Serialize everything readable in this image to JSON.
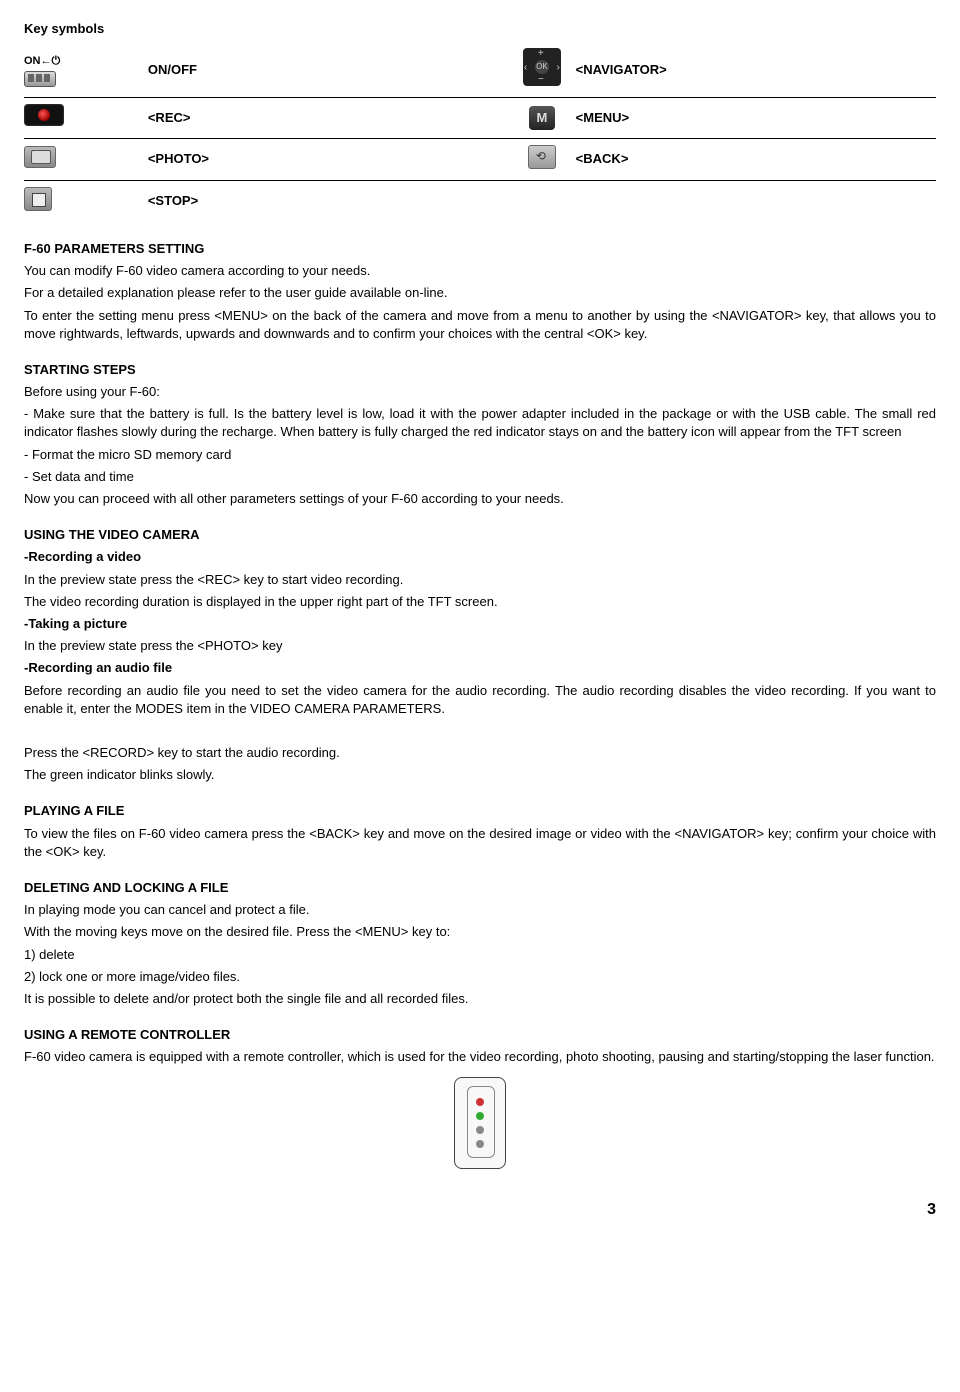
{
  "header": {
    "keySymbols": "Key symbols"
  },
  "symbols": {
    "onoff": "ON/OFF",
    "navigator": "<NAVIGATOR>",
    "rec": "<REC>",
    "menu": "<MENU>",
    "photo": "<PHOTO>",
    "back": "<BACK>",
    "stop": "<STOP>",
    "onArrow": "ON←⏻"
  },
  "params": {
    "title": "F-60 PARAMETERS SETTING",
    "p1": "You can modify F-60 video camera according to your needs.",
    "p2": "For a detailed explanation please refer to the user guide available on-line.",
    "p3": "To enter the setting menu press <MENU> on the back of the camera and move from a menu to another by using the <NAVIGATOR> key, that allows you to move rightwards, leftwards, upwards and downwards and to confirm your choices with the central  <OK> key."
  },
  "starting": {
    "title": "STARTING STEPS",
    "before": "Before using your F-60:",
    "l1": "- Make sure that the battery is full. Is the battery level is low, load it with the power adapter included in the package or with the USB cable. The small red indicator flashes slowly during the recharge. When battery is fully charged the red indicator stays on and the battery icon will appear from the TFT screen",
    "l2": "- Format the micro SD memory card",
    "l3": "- Set data and time",
    "after": "Now you can proceed with all other parameters settings of your F-60 according to your needs."
  },
  "usingVideo": {
    "title": "USING THE VIDEO CAMERA",
    "recHeading": "-Recording a video",
    "rec1": "In the preview state press the <REC> key to start video recording.",
    "rec2": "The video recording duration is displayed in the upper right part of the TFT screen.",
    "photoHeading": "-Taking a picture",
    "photo1": "In the preview state press the <PHOTO> key",
    "audioHeading": "-Recording an audio file",
    "audio1": "Before recording an audio file you need to set the video camera for the audio recording. The audio recording disables the video recording. If you want to enable it, enter the MODES item in the VIDEO CAMERA PARAMETERS.",
    "press": "Press the  <RECORD> key to start the audio recording.",
    "green": "The green indicator blinks slowly."
  },
  "playing": {
    "title": "PLAYING A FILE",
    "p1": "To view the files on F-60 video camera press the <BACK> key and move on the desired image or video with the <NAVIGATOR> key; confirm your choice with the  <OK> key."
  },
  "deleting": {
    "title": "DELETING AND LOCKING A FILE",
    "p1": "In playing mode you can cancel and protect a file.",
    "p2": "With the moving keys move on the desired file. Press the <MENU> key to:",
    "o1": "1) delete",
    "o2": "2) lock one or more image/video files.",
    "p3": "It is possible to delete and/or protect both the single file and all recorded files."
  },
  "remote": {
    "title": "USING A REMOTE CONTROLLER",
    "p1": "F-60 video camera is equipped with a remote controller, which is used for the video recording, photo shooting, pausing and starting/stopping the laser function."
  },
  "pageNumber": "3"
}
